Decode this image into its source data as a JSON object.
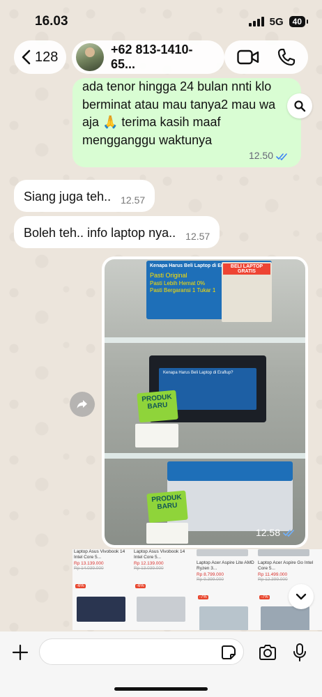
{
  "status_bar": {
    "time": "16.03",
    "network": "5G",
    "battery": "40"
  },
  "header": {
    "back_count": "128",
    "contact_name": "+62 813-1410-65...",
    "icons": [
      "chevron-left-icon",
      "video-call-icon",
      "phone-icon"
    ]
  },
  "messages": {
    "outgoing_text_lines": [
      "ada tenor hingga 24 bulan nnti klo",
      "berminat atau mau tanya2 mau wa",
      "aja 🙏 terima kasih maaf",
      "mengganggu waktunya"
    ],
    "outgoing_time": "12.50",
    "incoming": [
      {
        "text": "Siang juga teh..",
        "time": "12.57"
      },
      {
        "text": "Boleh teh.. info laptop nya..",
        "time": "12.57"
      }
    ],
    "image_time": "12.58"
  },
  "image": {
    "banner_top_title": "Kenapa Harus Beli Laptop di Erafone?",
    "banner_points": [
      "Pasti Original",
      "Pasti Lebih Hemat 0%",
      "Pasti Bergaransi 1 Tukar 1"
    ],
    "banner_mid_title": "Kenapa Harus Beli Laptop di Eraflup?",
    "beli_laptop": "BELI LAPTOP GRATIS",
    "produk_baru": "PRODUK BARU"
  },
  "products": [
    {
      "name": "Laptop Asus Vivobook 14 Intel Core 5...",
      "price": "Rp 13.139.000",
      "old": "Rp 14.039.000",
      "discount": "-6%",
      "color": "#2a3550"
    },
    {
      "name": "Laptop Asus Vivobook 14 Intel Core 5...",
      "price": "Rp 12.139.000",
      "old": "Rp 13.039.000",
      "discount": "-6%",
      "color": "#c9cdd2"
    },
    {
      "name": "Laptop Acer Aspire Lite AMD Ryzen 3...",
      "price": "Rp 8.799.000",
      "old": "Rp 9.399.000",
      "discount": "-7%",
      "color": "#b8c4cc"
    },
    {
      "name": "Laptop Acer Aspire Go Intel Core 5...",
      "price": "Rp 11.499.000",
      "old": "Rp 12.399.000",
      "discount": "-7%",
      "color": "#9aa7b3"
    }
  ],
  "input": {
    "placeholder": ""
  },
  "colors": {
    "outgoing_bubble": "#d9fdd3",
    "incoming_bubble": "#ffffff",
    "read_ticks": "#3b82f6"
  }
}
